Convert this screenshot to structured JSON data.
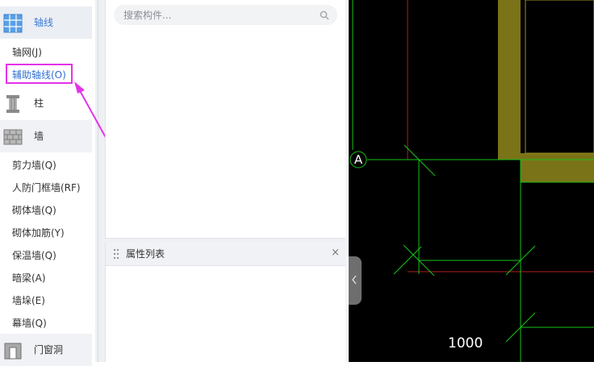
{
  "nav": {
    "categories": [
      {
        "label": "轴线",
        "icon": "axis-grid-icon"
      },
      {
        "label": "柱",
        "icon": "column-icon"
      },
      {
        "label": "墙",
        "icon": "brick-wall-icon"
      },
      {
        "label": "门窗洞",
        "icon": "door-window-icon"
      }
    ],
    "axis_items": [
      "轴网(J)",
      "辅助轴线(O)"
    ],
    "wall_items": [
      "剪力墙(Q)",
      "人防门框墙(RF)",
      "砌体墙(Q)",
      "砌体加筋(Y)",
      "保温墙(Q)",
      "暗梁(A)",
      "墙垛(E)",
      "幕墙(Q)"
    ]
  },
  "search": {
    "placeholder": "搜索构件..."
  },
  "property_panel": {
    "title": "属性列表",
    "close": "×"
  },
  "canvas": {
    "axis_label": "A",
    "dimension_text": "1000"
  },
  "colors": {
    "accent": "#3d7bd6",
    "highlight": "#e532e8",
    "axis_line": "#19c219",
    "wall_fill": "#7b7318",
    "red_line": "#b02020"
  }
}
